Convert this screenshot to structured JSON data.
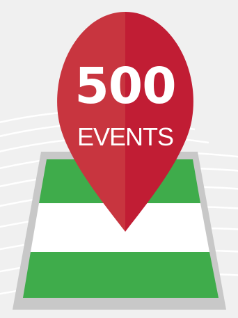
{
  "badge": {
    "count": "500",
    "label": "EVENTS"
  },
  "colors": {
    "background": "#f0f0f0",
    "pin_left": "#c8353f",
    "pin_right": "#c11d34",
    "map_border": "#c8c8c8",
    "map_green": "#3fac4b",
    "map_white": "#ffffff",
    "decorative_lines": "#ffffff"
  },
  "icons": {
    "pin": "map-pin-icon",
    "map": "folded-map-icon"
  }
}
